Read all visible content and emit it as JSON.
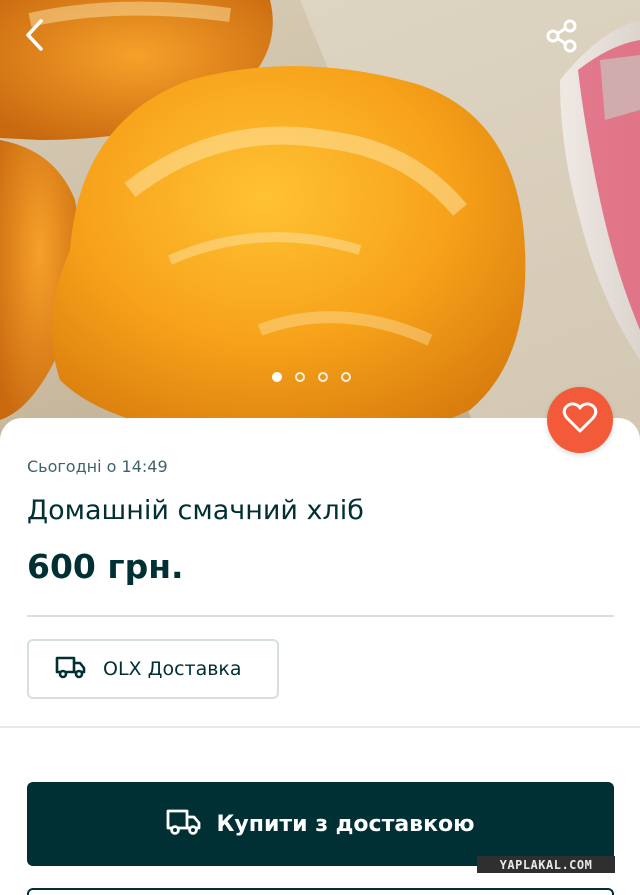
{
  "listing": {
    "posted": "Сьогодні о 14:49",
    "title": "Домашній смачний хліб",
    "price": "600 грн."
  },
  "gallery": {
    "image_count": 4,
    "active_index": 0,
    "image_subject": "homemade bread loaves"
  },
  "icons": {
    "back": "chevron-left-icon",
    "share": "share-icon",
    "favorite": "heart-icon",
    "delivery": "truck-icon"
  },
  "delivery": {
    "label": "OLX Доставка"
  },
  "actions": {
    "buy_label": "Купити з доставкою"
  },
  "watermark": {
    "text": "YAPLAKAL.COM"
  },
  "colors": {
    "primary": "#002f34",
    "favorite": "#f25a3a",
    "muted_text": "#406367",
    "divider": "#d8dfe0"
  }
}
